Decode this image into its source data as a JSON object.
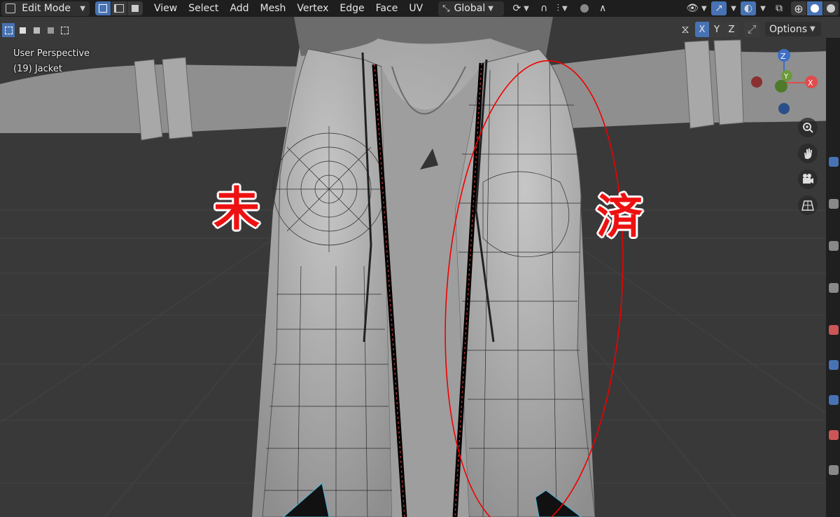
{
  "header": {
    "mode_label": "Edit Mode",
    "menus": [
      "View",
      "Select",
      "Add",
      "Mesh",
      "Vertex",
      "Edge",
      "Face",
      "UV"
    ],
    "orientation_label": "Global"
  },
  "toolbar2": {
    "axis_x": "X",
    "axis_y": "Y",
    "axis_z": "Z",
    "options_label": "Options"
  },
  "viewport": {
    "perspective_label": "User Perspective",
    "object_label": "(19) Jacket"
  },
  "gizmo": {
    "z_label": "Z",
    "y_label": "Y",
    "x_label": "X"
  },
  "annotations": {
    "left_mark": "未",
    "right_mark": "済"
  },
  "colors": {
    "accent": "#4772b3",
    "annotation_red": "#ee1111",
    "gizmo_x": "#e04b4b",
    "gizmo_y": "#6d9a3c",
    "gizmo_z": "#3f6fc4"
  },
  "icons": {
    "mode": "editmode-icon",
    "select_vertex": "vertex-select-icon",
    "select_edge": "edge-select-icon",
    "select_face": "face-select-icon",
    "transform_orientation": "orientation-icon",
    "pivot": "pivot-icon",
    "snap": "magnet-icon",
    "proportional": "proportional-edit-icon",
    "visibility": "eye-icon",
    "gizmo": "gizmo-icon",
    "overlay": "overlay-icon",
    "xray": "xray-icon",
    "shading": "shading-icon",
    "zoom": "zoom-icon",
    "pan": "hand-icon",
    "camera": "camera-icon",
    "grid": "grid-icon"
  }
}
